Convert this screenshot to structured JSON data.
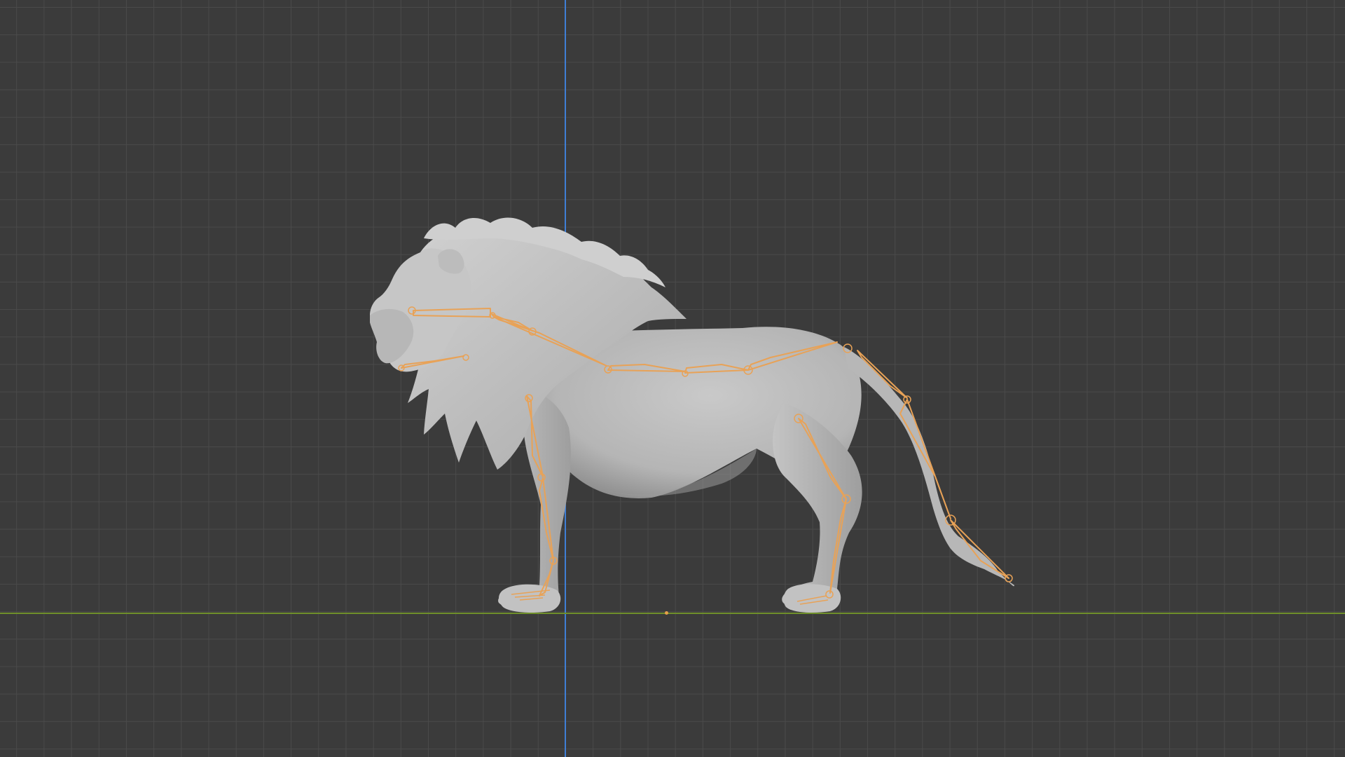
{
  "viewport": {
    "view": "front-orthographic",
    "grid_visible": true,
    "background_color": "#3b3b3b",
    "grid_color": "#4a4a4a",
    "axis_colors": {
      "vertical_axis": "#3f7fd6",
      "horizontal_axis": "#6f8f2a"
    },
    "origin_marker_color": "#e6a04a"
  },
  "object": {
    "mesh": "lion-mesh",
    "mesh_color": "#b9b9b9",
    "armature": "lion-armature",
    "armature_color": "#e8a257",
    "selected": true
  }
}
